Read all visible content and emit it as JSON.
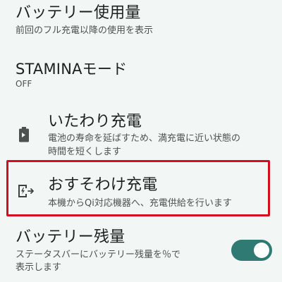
{
  "settings": {
    "battery_usage": {
      "title": "バッテリー使用量",
      "summary": "前回のフル充電以降の使用を表示"
    },
    "stamina_mode": {
      "title": "STAMINAモード",
      "summary": "OFF"
    },
    "itawari_charge": {
      "title": "いたわり充電",
      "summary_line1": "電池の寿命を延ばすため、満充電に近い状態の",
      "summary_line2": "時間を短くします",
      "icon": "battery-care-icon"
    },
    "osusowake_charge": {
      "title": "おすそわけ充電",
      "summary": "本機からQi対応機器へ、充電供給を行います",
      "icon": "wireless-power-share-icon",
      "highlight_color": "#d10f1f"
    },
    "battery_percentage": {
      "title": "バッテリー残量",
      "summary_line1": "ステータスバーにバッテリー残量を％で",
      "summary_line2": "表示します",
      "toggle_on": true
    }
  },
  "colors": {
    "background": "#f2f6f5",
    "accent": "#2f7a72"
  }
}
